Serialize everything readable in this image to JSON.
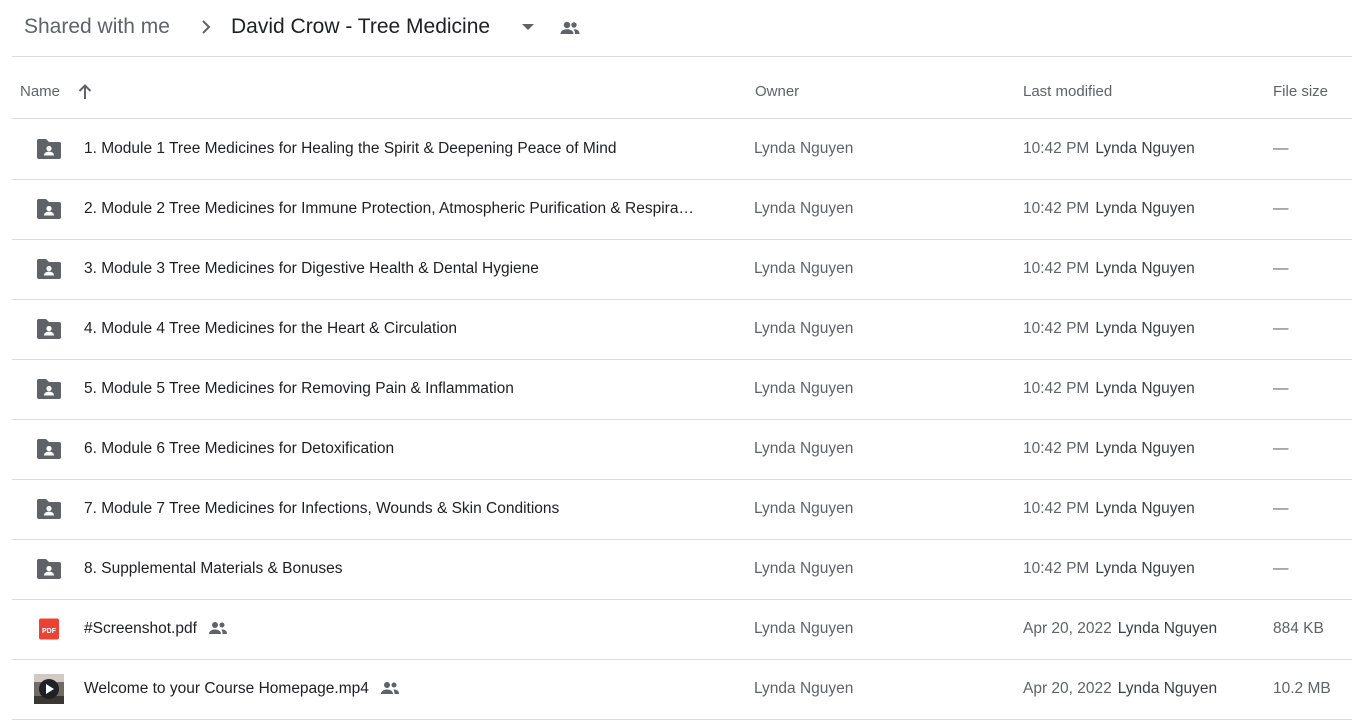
{
  "breadcrumb": {
    "root": "Shared with me",
    "current": "David Crow - Tree Medicine"
  },
  "columns": {
    "name": "Name",
    "owner": "Owner",
    "last_modified": "Last modified",
    "file_size": "File size"
  },
  "sort": {
    "column": "Name",
    "direction": "ascending",
    "icon": "arrow-up-icon"
  },
  "rows": [
    {
      "type": "folder",
      "name": "1. Module 1 Tree Medicines for Healing the Spirit & Deepening Peace of Mind",
      "owner": "Lynda Nguyen",
      "modified_time": "10:42 PM",
      "modified_by": "Lynda Nguyen",
      "size": "—"
    },
    {
      "type": "folder",
      "name": "2. Module 2 Tree Medicines for Immune Protection, Atmospheric Purification & Respira…",
      "owner": "Lynda Nguyen",
      "modified_time": "10:42 PM",
      "modified_by": "Lynda Nguyen",
      "size": "—"
    },
    {
      "type": "folder",
      "name": "3. Module 3 Tree Medicines for Digestive Health & Dental Hygiene",
      "owner": "Lynda Nguyen",
      "modified_time": "10:42 PM",
      "modified_by": "Lynda Nguyen",
      "size": "—"
    },
    {
      "type": "folder",
      "name": "4. Module 4 Tree Medicines for the Heart & Circulation",
      "owner": "Lynda Nguyen",
      "modified_time": "10:42 PM",
      "modified_by": "Lynda Nguyen",
      "size": "—"
    },
    {
      "type": "folder",
      "name": "5. Module 5 Tree Medicines for Removing Pain & Inflammation",
      "owner": "Lynda Nguyen",
      "modified_time": "10:42 PM",
      "modified_by": "Lynda Nguyen",
      "size": "—"
    },
    {
      "type": "folder",
      "name": "6. Module 6 Tree Medicines for Detoxification",
      "owner": "Lynda Nguyen",
      "modified_time": "10:42 PM",
      "modified_by": "Lynda Nguyen",
      "size": "—"
    },
    {
      "type": "folder",
      "name": "7. Module 7 Tree Medicines for Infections, Wounds & Skin Conditions",
      "owner": "Lynda Nguyen",
      "modified_time": "10:42 PM",
      "modified_by": "Lynda Nguyen",
      "size": "—"
    },
    {
      "type": "folder",
      "name": "8. Supplemental Materials & Bonuses",
      "owner": "Lynda Nguyen",
      "modified_time": "10:42 PM",
      "modified_by": "Lynda Nguyen",
      "size": "—"
    },
    {
      "type": "pdf",
      "name": "#Screenshot.pdf",
      "shared": true,
      "owner": "Lynda Nguyen",
      "modified_time": "Apr 20, 2022",
      "modified_by": "Lynda Nguyen",
      "size": "884 KB"
    },
    {
      "type": "video",
      "name": "Welcome to your Course Homepage.mp4",
      "shared": true,
      "owner": "Lynda Nguyen",
      "modified_time": "Apr 20, 2022",
      "modified_by": "Lynda Nguyen",
      "size": "10.2 MB"
    }
  ],
  "icons": {
    "folder": "shared-folder-icon",
    "pdf": "pdf-file-icon",
    "video": "video-file-icon",
    "shared": "people-icon",
    "pdf_label": "PDF"
  },
  "colors": {
    "folder_icon": "#5f6368",
    "pdf_icon": "#ea4335",
    "divider": "#dadce0"
  }
}
